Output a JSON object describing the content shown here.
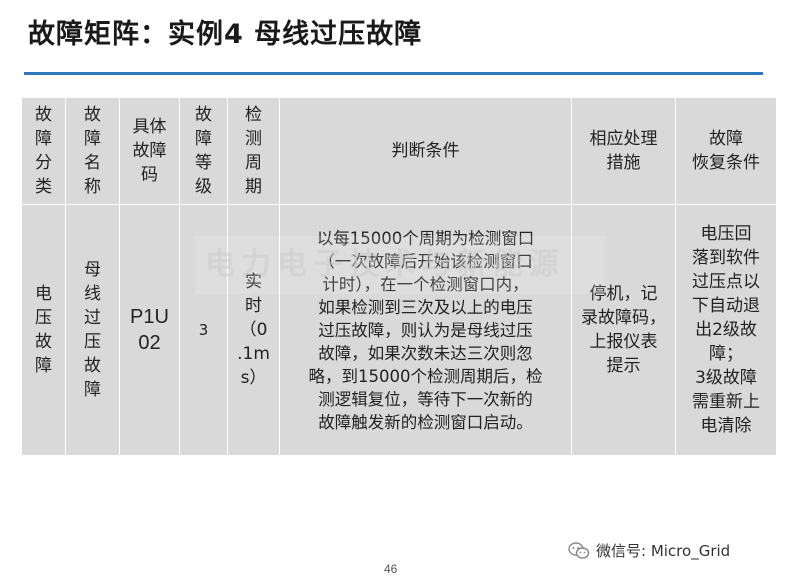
{
  "title": "故障矩阵：实例4 母线过压故障",
  "table": {
    "headers": [
      [
        "故",
        "障",
        "分",
        "类"
      ],
      [
        "故",
        "障",
        "名",
        "称"
      ],
      [
        "具体",
        "故障",
        "码"
      ],
      [
        "故",
        "障",
        "等",
        "级"
      ],
      [
        "检",
        "测",
        "周",
        "期"
      ],
      [
        "判断条件"
      ],
      [
        "相应处理",
        "措施"
      ],
      [
        "故障",
        "恢复条件"
      ]
    ],
    "row": {
      "category": [
        "电",
        "压",
        "故",
        "障"
      ],
      "name": [
        "母",
        "线",
        "过",
        "压",
        "故",
        "障"
      ],
      "code": [
        "P1U",
        "02"
      ],
      "level": "3",
      "period": [
        "实",
        "时",
        "（0",
        ".1m",
        "s）"
      ],
      "condition": [
        "以每15000个周期为检测窗口",
        "（一次故障后开始该检测窗口",
        "计时），在一个检测窗口内，",
        "如果检测到三次及以上的电压",
        "过压故障，则认为是母线过压",
        "故障，如果次数未达三次则忽",
        "略，到15000个检测周期后，检",
        "测逻辑复位，等待下一次新的",
        "故障触发新的检测窗口启动。"
      ],
      "action": [
        "停机，记",
        "录故障码，",
        "上报仪表",
        "提示"
      ],
      "recovery": [
        "电压回",
        "落到软件",
        "过压点以",
        "下自动退",
        "出2级故",
        "障；",
        "3级故障",
        "需重新上",
        "电清除"
      ]
    }
  },
  "watermark": "电力电子技术与新能源",
  "page_number": "46",
  "wechat_label": "微信号: Micro_Grid"
}
